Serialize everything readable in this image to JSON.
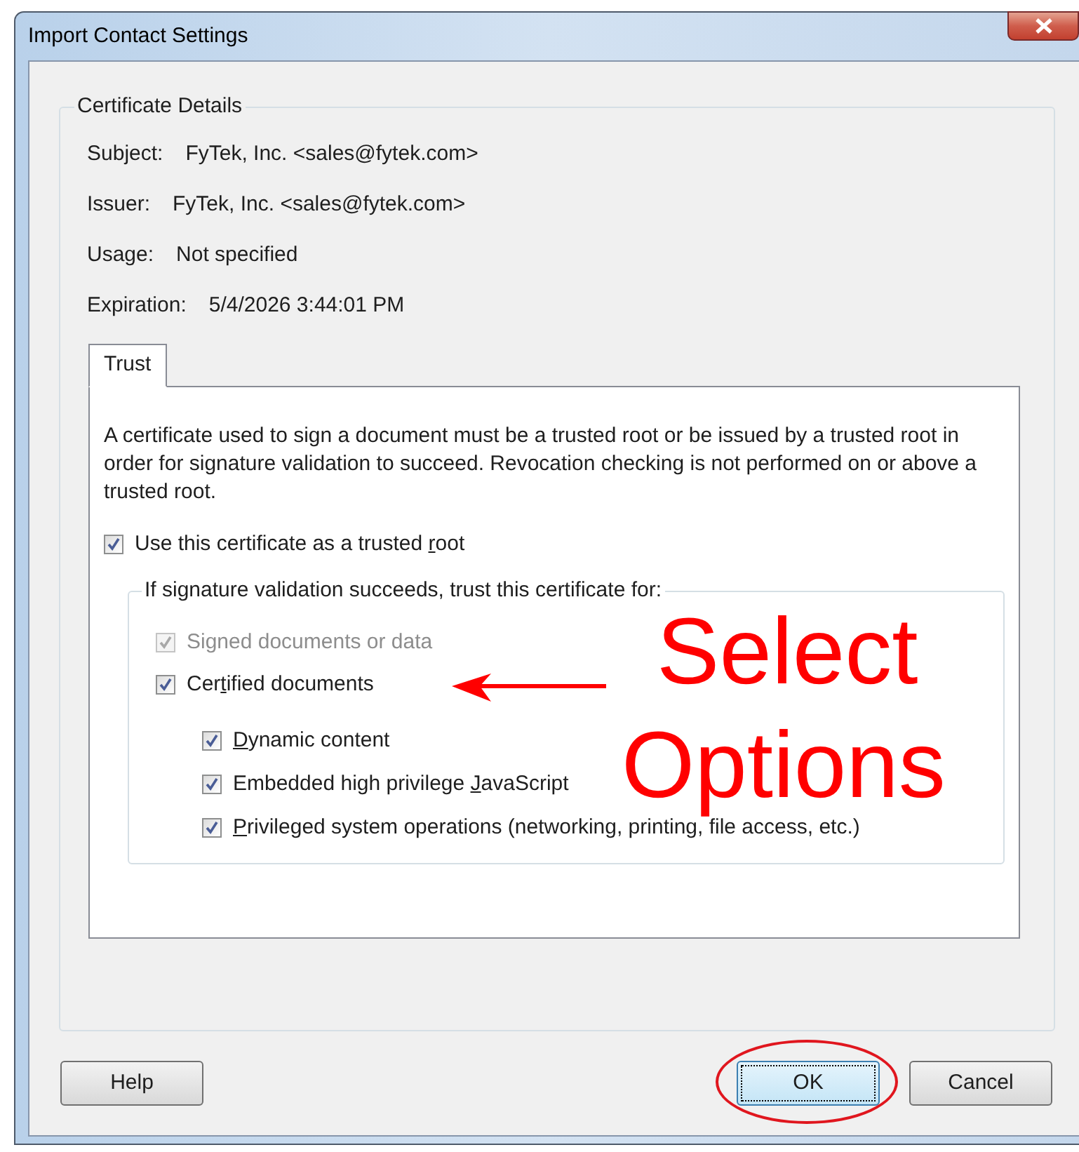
{
  "window": {
    "title": "Import Contact Settings"
  },
  "certificate_details": {
    "title": "Certificate Details",
    "fields": [
      {
        "label": "Subject:",
        "value": "FyTek, Inc. <sales@fytek.com>"
      },
      {
        "label": "Issuer:",
        "value": "FyTek, Inc. <sales@fytek.com>"
      },
      {
        "label": "Usage:",
        "value": "Not specified"
      },
      {
        "label": "Expiration:",
        "value": "5/4/2026 3:44:01 PM"
      }
    ]
  },
  "tabs": [
    {
      "label": "Trust",
      "selected": true
    }
  ],
  "trust": {
    "description": "A certificate used to sign a document must be a trusted root or be issued by a trusted root in order for signature validation to succeed.  Revocation checking is not performed on or above a trusted root.",
    "trusted_root": {
      "label_parts": [
        {
          "text": "Use this certificate as a trusted "
        },
        {
          "text": "r",
          "access_key": true
        },
        {
          "text": "oot"
        }
      ],
      "checked": true,
      "disabled": false
    },
    "trust_for": {
      "title": "If signature validation succeeds, trust this certificate for:",
      "options": [
        {
          "label_parts": [
            {
              "text": "Signed documents or data"
            }
          ],
          "checked": true,
          "disabled": true
        },
        {
          "label_parts": [
            {
              "text": "Cer"
            },
            {
              "text": "t",
              "access_key": true
            },
            {
              "text": "ified documents"
            }
          ],
          "checked": true,
          "disabled": false,
          "children": [
            {
              "label_parts": [
                {
                  "text": "D",
                  "access_key": true
                },
                {
                  "text": "ynamic content"
                }
              ],
              "checked": true,
              "disabled": false
            },
            {
              "label_parts": [
                {
                  "text": "Embedded high privilege "
                },
                {
                  "text": "J",
                  "access_key": true
                },
                {
                  "text": "avaScript"
                }
              ],
              "checked": true,
              "disabled": false
            },
            {
              "label_parts": [
                {
                  "text": "P",
                  "access_key": true
                },
                {
                  "text": "rivileged system operations (networking, printing, file access, etc.)"
                }
              ],
              "checked": true,
              "disabled": false
            }
          ]
        }
      ]
    }
  },
  "buttons": [
    {
      "label": "Help",
      "default": false,
      "circled": false
    },
    {
      "label": "OK",
      "default": true,
      "circled": true
    },
    {
      "label": "Cancel",
      "default": false,
      "circled": false
    }
  ],
  "annotation": {
    "lines": [
      "Select",
      "Options"
    ],
    "arrow": true
  }
}
